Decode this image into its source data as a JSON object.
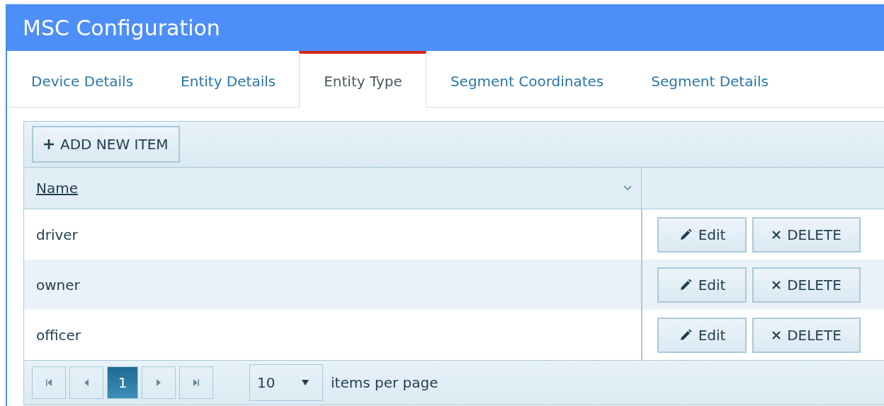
{
  "window": {
    "title": "MSC Configuration"
  },
  "tabs": [
    {
      "label": "Device Details",
      "selected": false
    },
    {
      "label": "Entity Details",
      "selected": false
    },
    {
      "label": "Entity Type",
      "selected": true
    },
    {
      "label": "Segment Coordinates",
      "selected": false
    },
    {
      "label": "Segment Details",
      "selected": false
    }
  ],
  "toolbar": {
    "add_button": "ADD NEW ITEM"
  },
  "table": {
    "columns": [
      {
        "label": "Name"
      }
    ],
    "rows": [
      {
        "name": "driver",
        "edit": "Edit",
        "delete": "DELETE"
      },
      {
        "name": "owner",
        "edit": "Edit",
        "delete": "DELETE"
      },
      {
        "name": "officer",
        "edit": "Edit",
        "delete": "DELETE"
      }
    ]
  },
  "pager": {
    "pages": [
      {
        "label": "1",
        "selected": true
      }
    ],
    "page_size": "10",
    "page_size_label": "items per page"
  }
}
